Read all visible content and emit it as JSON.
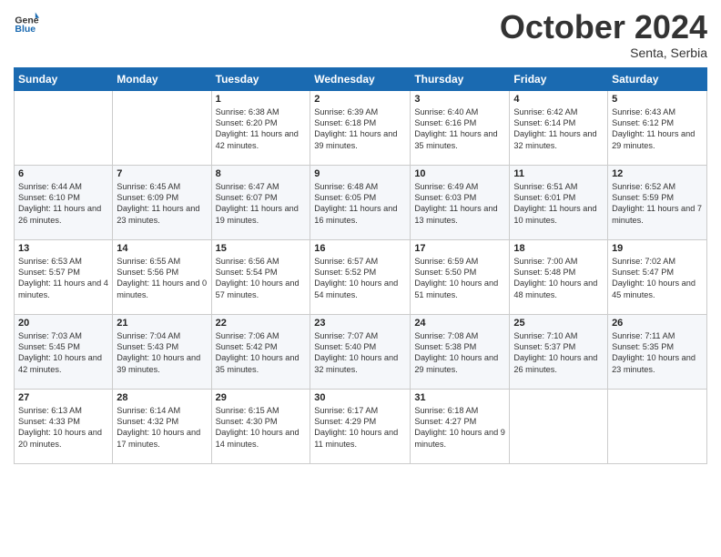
{
  "header": {
    "logo_general": "General",
    "logo_blue": "Blue",
    "month_title": "October 2024",
    "location": "Senta, Serbia"
  },
  "weekdays": [
    "Sunday",
    "Monday",
    "Tuesday",
    "Wednesday",
    "Thursday",
    "Friday",
    "Saturday"
  ],
  "weeks": [
    [
      {
        "day": "",
        "sunrise": "",
        "sunset": "",
        "daylight": ""
      },
      {
        "day": "",
        "sunrise": "",
        "sunset": "",
        "daylight": ""
      },
      {
        "day": "1",
        "sunrise": "Sunrise: 6:38 AM",
        "sunset": "Sunset: 6:20 PM",
        "daylight": "Daylight: 11 hours and 42 minutes."
      },
      {
        "day": "2",
        "sunrise": "Sunrise: 6:39 AM",
        "sunset": "Sunset: 6:18 PM",
        "daylight": "Daylight: 11 hours and 39 minutes."
      },
      {
        "day": "3",
        "sunrise": "Sunrise: 6:40 AM",
        "sunset": "Sunset: 6:16 PM",
        "daylight": "Daylight: 11 hours and 35 minutes."
      },
      {
        "day": "4",
        "sunrise": "Sunrise: 6:42 AM",
        "sunset": "Sunset: 6:14 PM",
        "daylight": "Daylight: 11 hours and 32 minutes."
      },
      {
        "day": "5",
        "sunrise": "Sunrise: 6:43 AM",
        "sunset": "Sunset: 6:12 PM",
        "daylight": "Daylight: 11 hours and 29 minutes."
      }
    ],
    [
      {
        "day": "6",
        "sunrise": "Sunrise: 6:44 AM",
        "sunset": "Sunset: 6:10 PM",
        "daylight": "Daylight: 11 hours and 26 minutes."
      },
      {
        "day": "7",
        "sunrise": "Sunrise: 6:45 AM",
        "sunset": "Sunset: 6:09 PM",
        "daylight": "Daylight: 11 hours and 23 minutes."
      },
      {
        "day": "8",
        "sunrise": "Sunrise: 6:47 AM",
        "sunset": "Sunset: 6:07 PM",
        "daylight": "Daylight: 11 hours and 19 minutes."
      },
      {
        "day": "9",
        "sunrise": "Sunrise: 6:48 AM",
        "sunset": "Sunset: 6:05 PM",
        "daylight": "Daylight: 11 hours and 16 minutes."
      },
      {
        "day": "10",
        "sunrise": "Sunrise: 6:49 AM",
        "sunset": "Sunset: 6:03 PM",
        "daylight": "Daylight: 11 hours and 13 minutes."
      },
      {
        "day": "11",
        "sunrise": "Sunrise: 6:51 AM",
        "sunset": "Sunset: 6:01 PM",
        "daylight": "Daylight: 11 hours and 10 minutes."
      },
      {
        "day": "12",
        "sunrise": "Sunrise: 6:52 AM",
        "sunset": "Sunset: 5:59 PM",
        "daylight": "Daylight: 11 hours and 7 minutes."
      }
    ],
    [
      {
        "day": "13",
        "sunrise": "Sunrise: 6:53 AM",
        "sunset": "Sunset: 5:57 PM",
        "daylight": "Daylight: 11 hours and 4 minutes."
      },
      {
        "day": "14",
        "sunrise": "Sunrise: 6:55 AM",
        "sunset": "Sunset: 5:56 PM",
        "daylight": "Daylight: 11 hours and 0 minutes."
      },
      {
        "day": "15",
        "sunrise": "Sunrise: 6:56 AM",
        "sunset": "Sunset: 5:54 PM",
        "daylight": "Daylight: 10 hours and 57 minutes."
      },
      {
        "day": "16",
        "sunrise": "Sunrise: 6:57 AM",
        "sunset": "Sunset: 5:52 PM",
        "daylight": "Daylight: 10 hours and 54 minutes."
      },
      {
        "day": "17",
        "sunrise": "Sunrise: 6:59 AM",
        "sunset": "Sunset: 5:50 PM",
        "daylight": "Daylight: 10 hours and 51 minutes."
      },
      {
        "day": "18",
        "sunrise": "Sunrise: 7:00 AM",
        "sunset": "Sunset: 5:48 PM",
        "daylight": "Daylight: 10 hours and 48 minutes."
      },
      {
        "day": "19",
        "sunrise": "Sunrise: 7:02 AM",
        "sunset": "Sunset: 5:47 PM",
        "daylight": "Daylight: 10 hours and 45 minutes."
      }
    ],
    [
      {
        "day": "20",
        "sunrise": "Sunrise: 7:03 AM",
        "sunset": "Sunset: 5:45 PM",
        "daylight": "Daylight: 10 hours and 42 minutes."
      },
      {
        "day": "21",
        "sunrise": "Sunrise: 7:04 AM",
        "sunset": "Sunset: 5:43 PM",
        "daylight": "Daylight: 10 hours and 39 minutes."
      },
      {
        "day": "22",
        "sunrise": "Sunrise: 7:06 AM",
        "sunset": "Sunset: 5:42 PM",
        "daylight": "Daylight: 10 hours and 35 minutes."
      },
      {
        "day": "23",
        "sunrise": "Sunrise: 7:07 AM",
        "sunset": "Sunset: 5:40 PM",
        "daylight": "Daylight: 10 hours and 32 minutes."
      },
      {
        "day": "24",
        "sunrise": "Sunrise: 7:08 AM",
        "sunset": "Sunset: 5:38 PM",
        "daylight": "Daylight: 10 hours and 29 minutes."
      },
      {
        "day": "25",
        "sunrise": "Sunrise: 7:10 AM",
        "sunset": "Sunset: 5:37 PM",
        "daylight": "Daylight: 10 hours and 26 minutes."
      },
      {
        "day": "26",
        "sunrise": "Sunrise: 7:11 AM",
        "sunset": "Sunset: 5:35 PM",
        "daylight": "Daylight: 10 hours and 23 minutes."
      }
    ],
    [
      {
        "day": "27",
        "sunrise": "Sunrise: 6:13 AM",
        "sunset": "Sunset: 4:33 PM",
        "daylight": "Daylight: 10 hours and 20 minutes."
      },
      {
        "day": "28",
        "sunrise": "Sunrise: 6:14 AM",
        "sunset": "Sunset: 4:32 PM",
        "daylight": "Daylight: 10 hours and 17 minutes."
      },
      {
        "day": "29",
        "sunrise": "Sunrise: 6:15 AM",
        "sunset": "Sunset: 4:30 PM",
        "daylight": "Daylight: 10 hours and 14 minutes."
      },
      {
        "day": "30",
        "sunrise": "Sunrise: 6:17 AM",
        "sunset": "Sunset: 4:29 PM",
        "daylight": "Daylight: 10 hours and 11 minutes."
      },
      {
        "day": "31",
        "sunrise": "Sunrise: 6:18 AM",
        "sunset": "Sunset: 4:27 PM",
        "daylight": "Daylight: 10 hours and 9 minutes."
      },
      {
        "day": "",
        "sunrise": "",
        "sunset": "",
        "daylight": ""
      },
      {
        "day": "",
        "sunrise": "",
        "sunset": "",
        "daylight": ""
      }
    ]
  ]
}
